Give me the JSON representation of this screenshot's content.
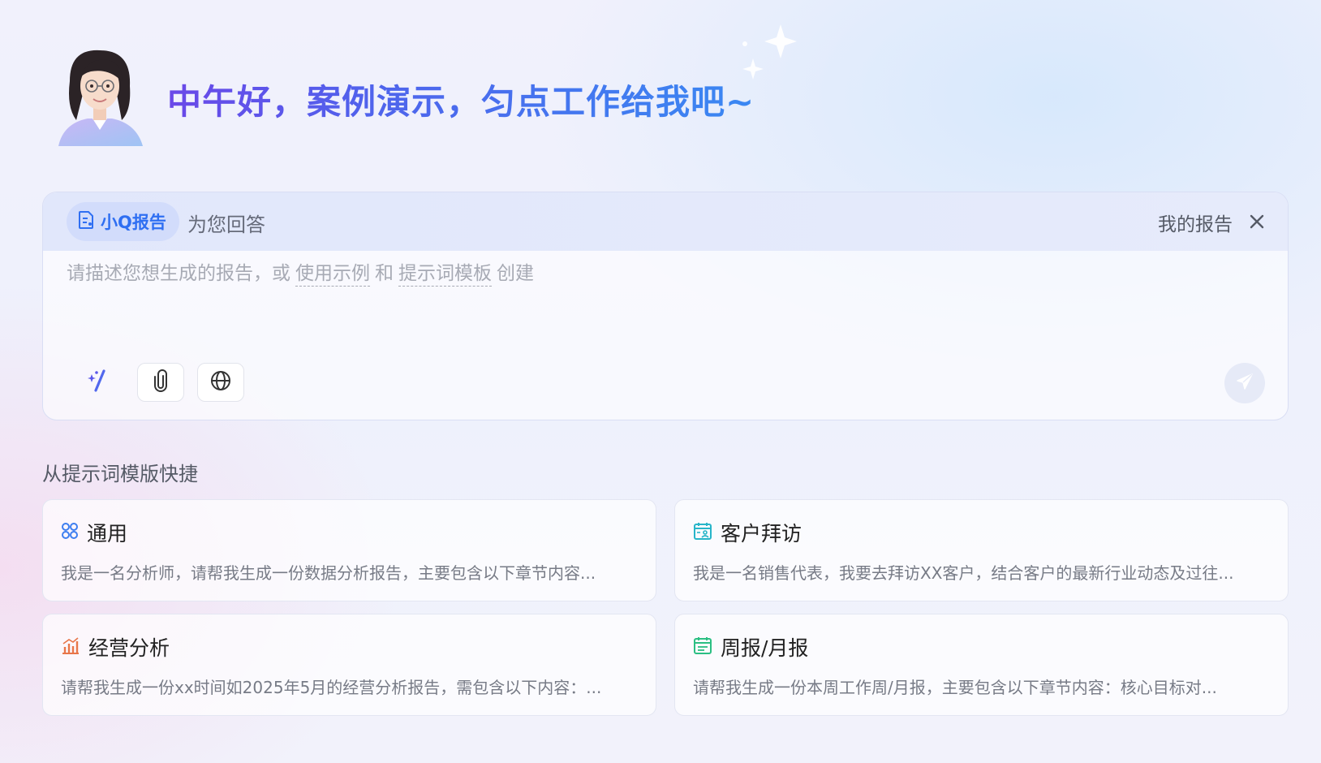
{
  "greeting": "中午好，案例演示，匀点工作给我吧~",
  "agent": {
    "name": "小Q报告",
    "suffix": "为您回答",
    "my_report": "我的报告"
  },
  "input": {
    "placeholder_prefix": "请描述您想生成的报告，或",
    "link_examples": "使用示例",
    "joiner": "和",
    "link_templates": "提示词模板",
    "placeholder_suffix": "创建"
  },
  "section_title": "从提示词模版快捷",
  "templates": [
    {
      "title": "通用",
      "icon": "grid-icon",
      "color": "#3d7ef0",
      "desc": "我是一名分析师，请帮我生成一份数据分析报告，主要包含以下章节内容..."
    },
    {
      "title": "客户拜访",
      "icon": "calendar-user-icon",
      "color": "#27b5c9",
      "desc": "我是一名销售代表，我要去拜访XX客户，结合客户的最新行业动态及过往..."
    },
    {
      "title": "经营分析",
      "icon": "bar-chart-icon",
      "color": "#e8764a",
      "desc": "请帮我生成一份xx时间如2025年5月的经营分析报告，需包含以下内容：..."
    },
    {
      "title": "周报/月报",
      "icon": "calendar-icon",
      "color": "#2bbf83",
      "desc": "请帮我生成一份本周工作周/月报，主要包含以下章节内容：核心目标对..."
    }
  ],
  "colors": {
    "accent": "#2f6ff2",
    "gradient_start": "#6a48e8",
    "gradient_end": "#3a88f2"
  }
}
